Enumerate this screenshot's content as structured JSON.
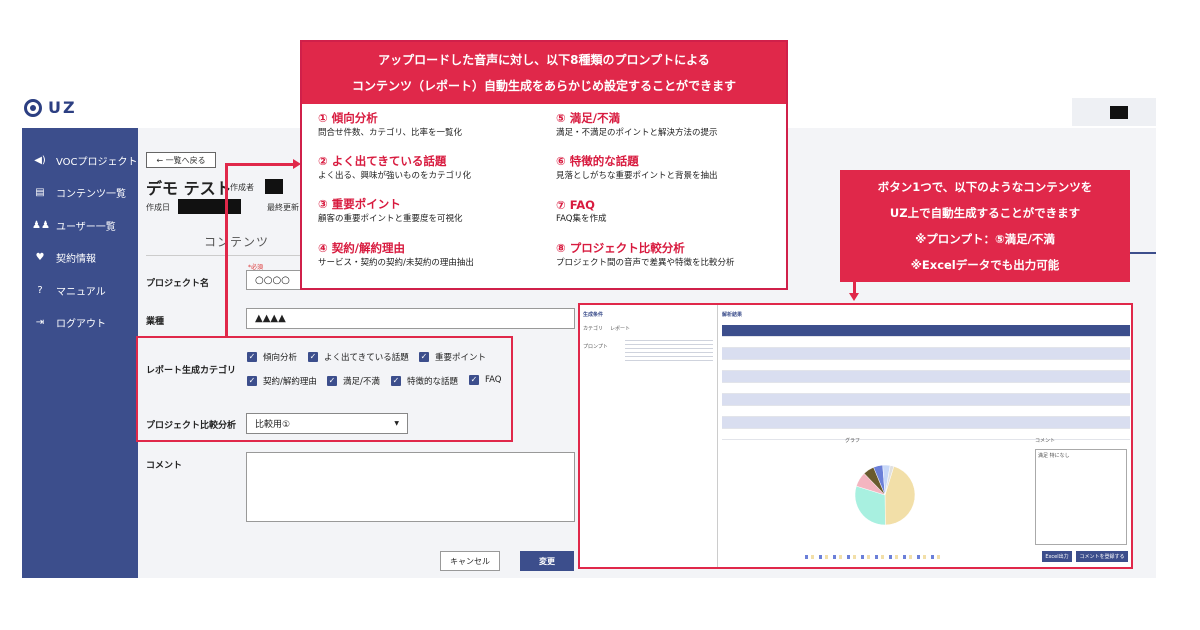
{
  "app": {
    "logo_text": "UZ"
  },
  "sidebar": {
    "items": [
      {
        "label": "VOCプロジェクト",
        "icon": "speaker-icon"
      },
      {
        "label": "コンテンツ一覧",
        "icon": "document-icon"
      },
      {
        "label": "ユーザー一覧",
        "icon": "users-icon"
      },
      {
        "label": "契約情報",
        "icon": "handshake-icon"
      },
      {
        "label": "マニュアル",
        "icon": "question-icon"
      },
      {
        "label": "ログアウト",
        "icon": "logout-icon"
      }
    ]
  },
  "page": {
    "back_label": "← 一覧へ戻る",
    "title": "デモ テスト",
    "creator_label": "作成者",
    "created_label": "作成日",
    "updated_label": "最終更新",
    "tab_label": "コンテンツ"
  },
  "form": {
    "required_mark": "*必須",
    "project_name_label": "プロジェクト名",
    "project_name_value": "○○○○",
    "industry_label": "業種",
    "industry_value": "▲▲▲▲",
    "report_category_label": "レポート生成カテゴリ",
    "categories_row1": [
      "傾向分析",
      "よく出てきている話題",
      "重要ポイント"
    ],
    "categories_row2": [
      "契約/解約理由",
      "満足/不満",
      "特徴的な話題",
      "FAQ"
    ],
    "compare_label": "プロジェクト比較分析",
    "compare_value": "比較用①",
    "comment_label": "コメント",
    "cancel_label": "キャンセル",
    "submit_label": "変更"
  },
  "callout_top": {
    "header_line1": "アップロードした音声に対し、以下8種類のプロンプトによる",
    "header_line2": "コンテンツ（レポート）自動生成をあらかじめ設定することができます",
    "prompts": [
      {
        "title": "① 傾向分析",
        "desc": "問合せ件数、カテゴリ、比率を一覧化"
      },
      {
        "title": "② よく出てきている話題",
        "desc": "よく出る、興味が強いものをカテゴリ化"
      },
      {
        "title": "③ 重要ポイント",
        "desc": "顧客の重要ポイントと重要度を可視化"
      },
      {
        "title": "④ 契約/解約理由",
        "desc": "サービス・契約の契約/未契約の理由抽出"
      },
      {
        "title": "⑤ 満足/不満",
        "desc": "満足・不満足のポイントと解決方法の提示"
      },
      {
        "title": "⑥ 特徴的な話題",
        "desc": "見落としがちな重要ポイントと背景を抽出"
      },
      {
        "title": "⑦ FAQ",
        "desc": "FAQ集を作成"
      },
      {
        "title": "⑧ プロジェクト比較分析",
        "desc": "プロジェクト間の音声で差異や特徴を比較分析"
      }
    ]
  },
  "callout_right": {
    "line1": "ボタン1つで、以下のようなコンテンツを",
    "line2": "UZ上で自動生成することができます",
    "line3": "※プロンプト：⑤満足/不満",
    "line4": "※Excelデータでも出力可能"
  },
  "preview": {
    "cond_label": "生成条件",
    "cat_label": "カテゴリ",
    "cat_value": "レポート",
    "prompt_label": "プロンプト",
    "result_label": "解析結果",
    "graph_label": "グラフ",
    "comment_label": "コメント",
    "comment_value": "満足 特になし",
    "excel_btn": "Excel出力",
    "save_btn": "コメントを登録する",
    "pie_values": [
      45,
      30,
      8,
      6,
      5,
      4,
      2
    ],
    "pie_colors": [
      "#f2dfa8",
      "#a8f0e0",
      "#f4b5c0",
      "#6a5a2e",
      "#6b7fd8",
      "#c8d8f8",
      "#e0e0e0"
    ]
  }
}
